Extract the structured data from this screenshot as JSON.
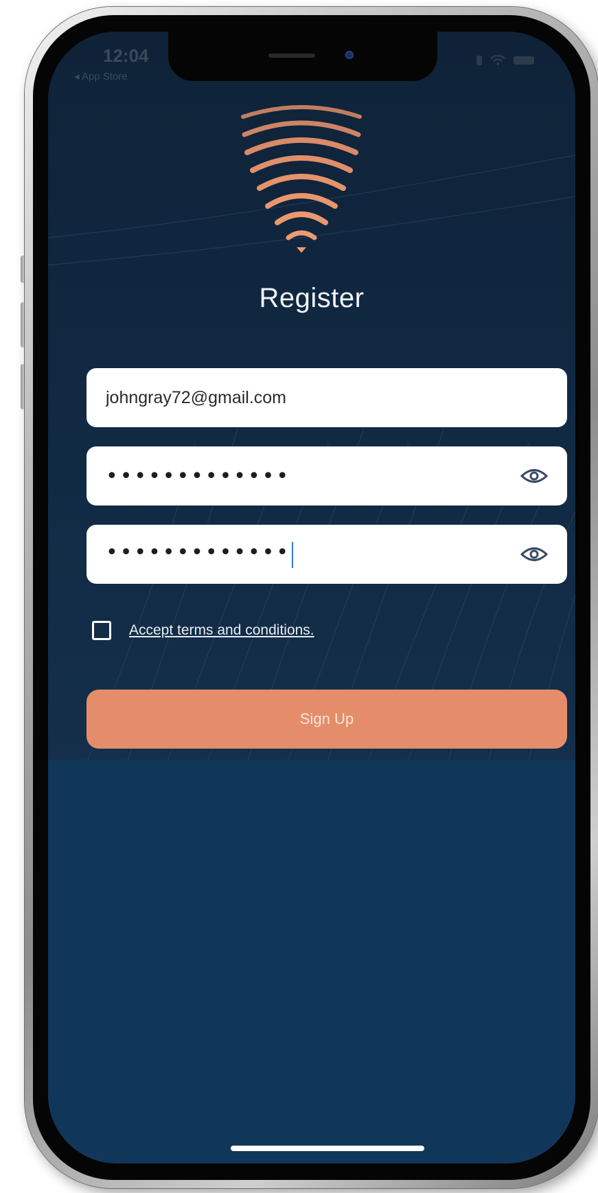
{
  "status_bar": {
    "time": "12:04",
    "back_label": "◂ App Store"
  },
  "screen": {
    "title": "Register"
  },
  "form": {
    "email_value": "johngray72@gmail.com",
    "password_value": "•••••••••••••",
    "confirm_password_value": "•••••••••••••",
    "terms_label": "Accept terms and conditions.",
    "terms_checked": false,
    "signup_label": "Sign Up"
  },
  "icons": {
    "logo": "shield-waves-logo",
    "password_toggle": "eye-icon",
    "confirm_toggle": "eye-icon"
  },
  "colors": {
    "background_top": "#0f2238",
    "background_bottom": "#10375a",
    "accent": "#e58d6a",
    "field_background": "#ffffff",
    "title_text": "#f2f4f7"
  }
}
